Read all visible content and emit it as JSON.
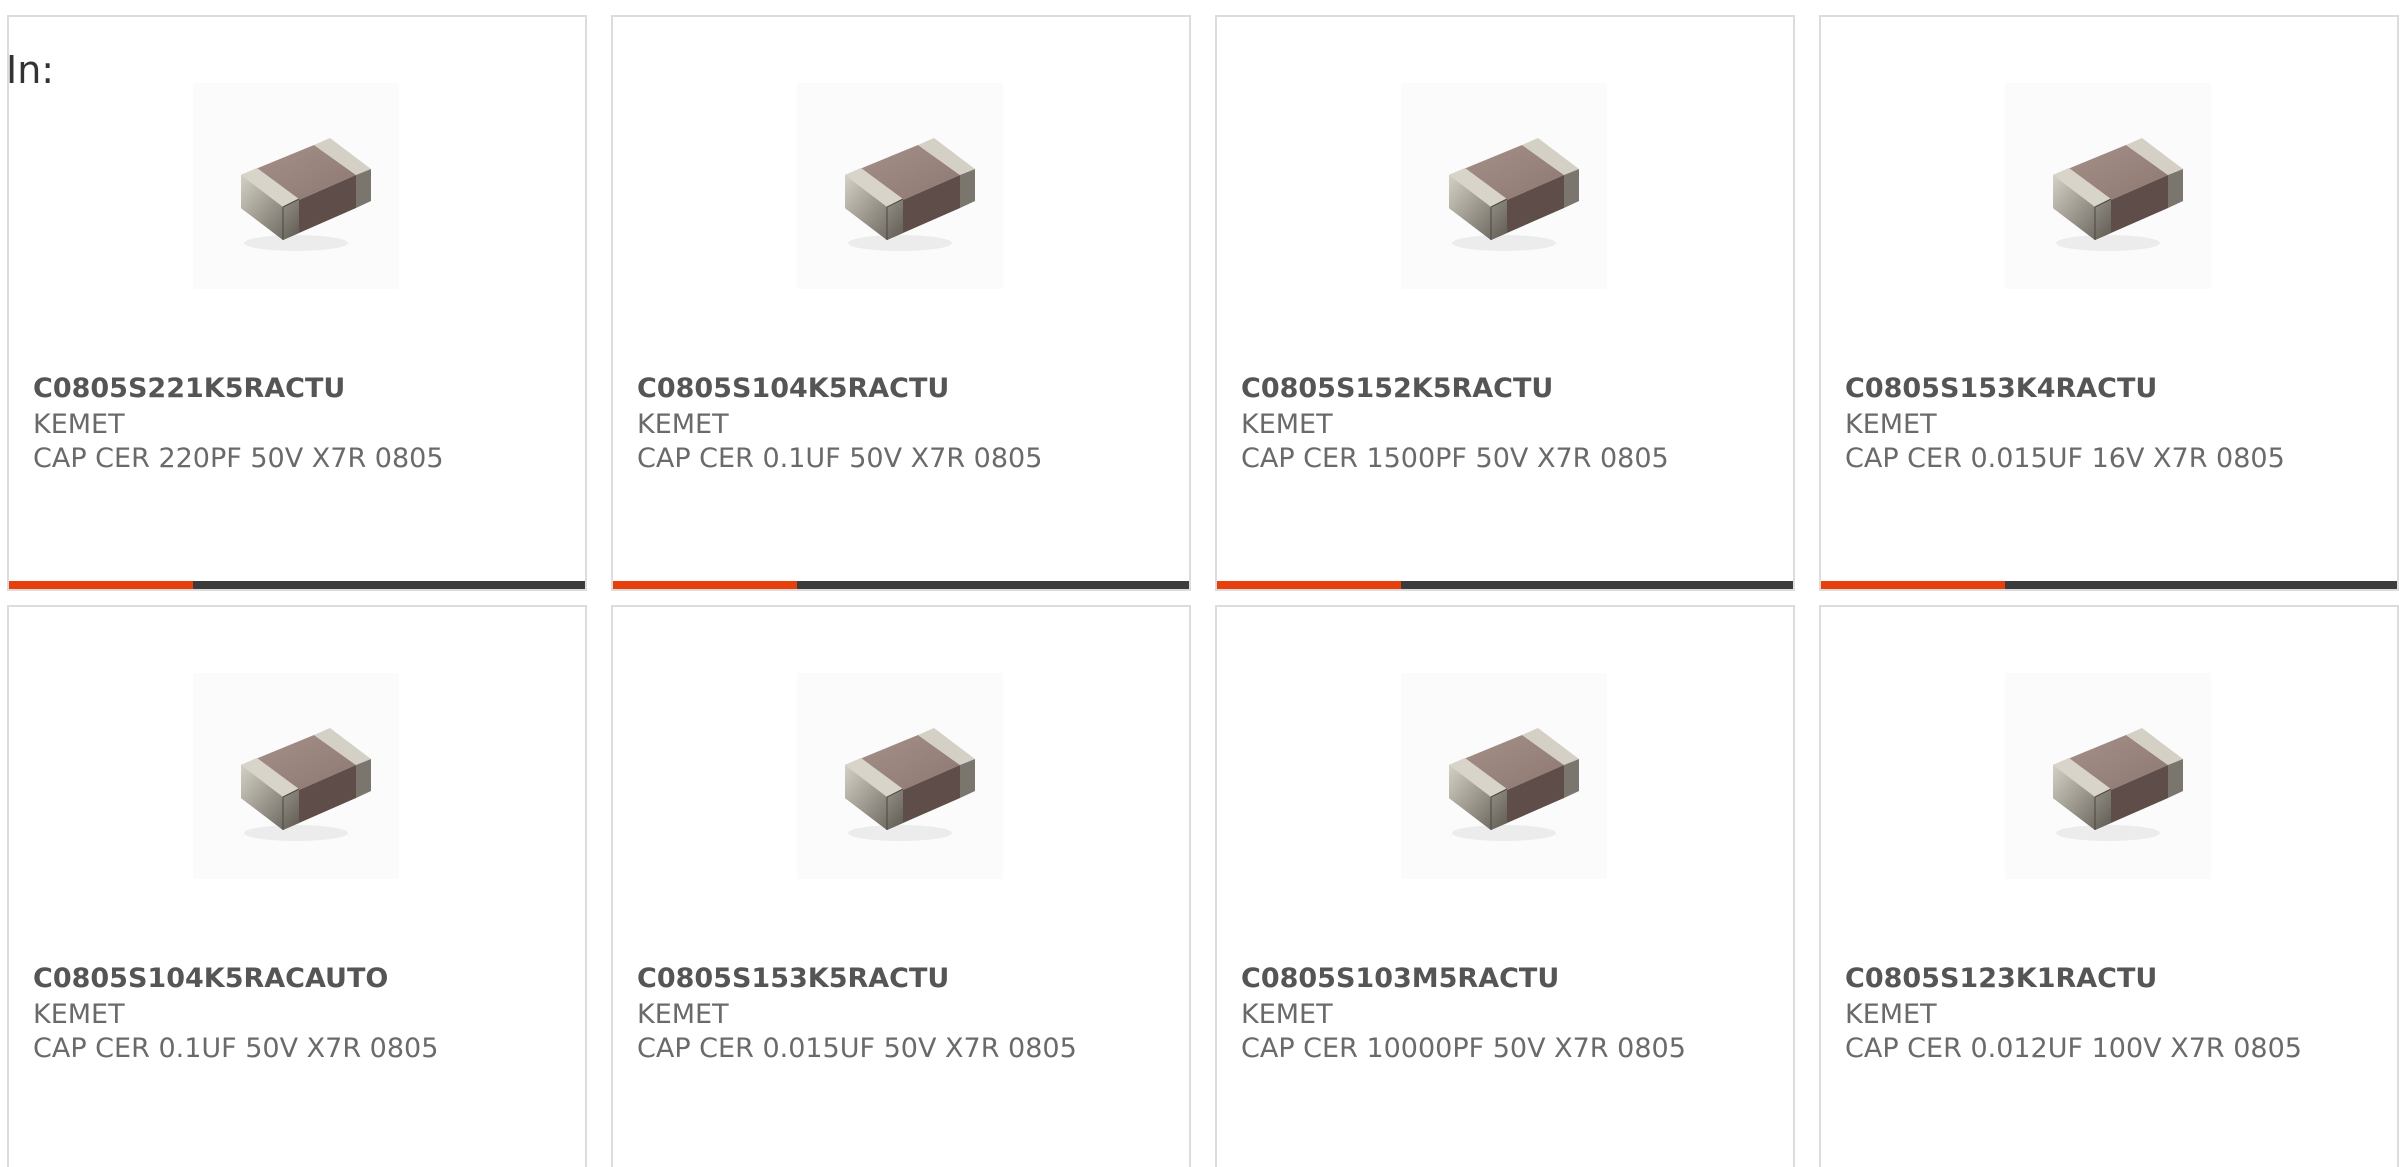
{
  "filter_label": "In:",
  "accent_color": "#e8400c",
  "bar_track_color": "#3b3b3b",
  "cards": [
    {
      "part_number": "C0805S221K5RACTU",
      "manufacturer": "KEMET",
      "description": "CAP CER 220PF 50V X7R 0805",
      "progress_fraction": 0.32,
      "image": "capacitor-0805-icon"
    },
    {
      "part_number": "C0805S104K5RACTU",
      "manufacturer": "KEMET",
      "description": "CAP CER 0.1UF 50V X7R 0805",
      "progress_fraction": 0.32,
      "image": "capacitor-0805-icon"
    },
    {
      "part_number": "C0805S152K5RACTU",
      "manufacturer": "KEMET",
      "description": "CAP CER 1500PF 50V X7R 0805",
      "progress_fraction": 0.32,
      "image": "capacitor-0805-icon"
    },
    {
      "part_number": "C0805S153K4RACTU",
      "manufacturer": "KEMET",
      "description": "CAP CER 0.015UF 16V X7R 0805",
      "progress_fraction": 0.32,
      "image": "capacitor-0805-icon"
    },
    {
      "part_number": "C0805S104K5RACAUTO",
      "manufacturer": "KEMET",
      "description": "CAP CER 0.1UF 50V X7R 0805",
      "progress_fraction": null,
      "image": "capacitor-0805-icon"
    },
    {
      "part_number": "C0805S153K5RACTU",
      "manufacturer": "KEMET",
      "description": "CAP CER 0.015UF 50V X7R 0805",
      "progress_fraction": null,
      "image": "capacitor-0805-icon"
    },
    {
      "part_number": "C0805S103M5RACTU",
      "manufacturer": "KEMET",
      "description": "CAP CER 10000PF 50V X7R 0805",
      "progress_fraction": null,
      "image": "capacitor-0805-icon"
    },
    {
      "part_number": "C0805S123K1RACTU",
      "manufacturer": "KEMET",
      "description": "CAP CER 0.012UF 100V X7R 0805",
      "progress_fraction": null,
      "image": "capacitor-0805-icon"
    }
  ]
}
